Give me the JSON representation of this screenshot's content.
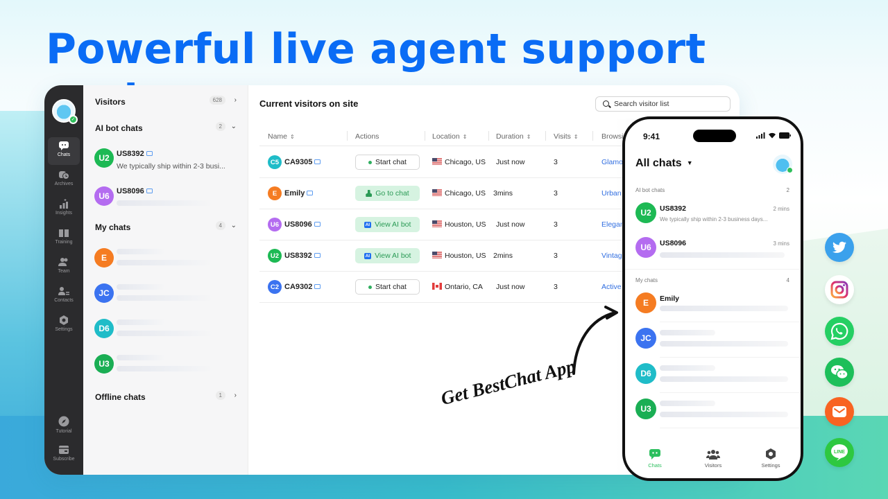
{
  "headline": "Powerful live agent support system",
  "rail": {
    "items": [
      {
        "label": "Chats",
        "icon": "chat-bubble-icon",
        "active": true
      },
      {
        "label": "Archives",
        "icon": "archive-clock-icon"
      },
      {
        "label": "Insights",
        "icon": "insights-chart-icon"
      },
      {
        "label": "Training",
        "icon": "book-icon"
      },
      {
        "label": "Team",
        "icon": "team-icon"
      },
      {
        "label": "Contacts",
        "icon": "contacts-icon"
      },
      {
        "label": "Settings",
        "icon": "gear-icon"
      }
    ],
    "bottom": [
      {
        "label": "Tutorial",
        "icon": "compass-icon"
      },
      {
        "label": "Subscribe",
        "icon": "card-icon"
      }
    ]
  },
  "list": {
    "visitors": {
      "title": "Visitors",
      "count": "628"
    },
    "ai_bot": {
      "title": "AI bot chats",
      "count": "2",
      "items": [
        {
          "initials": "U2",
          "color": "#1db954",
          "name": "US8392",
          "message": "We typically ship within 2-3 busi..."
        },
        {
          "initials": "U6",
          "color": "#b46cf0",
          "name": "US8096",
          "message": ""
        }
      ]
    },
    "my_chats": {
      "title": "My chats",
      "count": "4",
      "items": [
        {
          "initials": "E",
          "color": "#f57c22"
        },
        {
          "initials": "JC",
          "color": "#3b73f0"
        },
        {
          "initials": "D6",
          "color": "#1fbcc8"
        },
        {
          "initials": "U3",
          "color": "#1aae54"
        }
      ]
    },
    "offline": {
      "title": "Offline chats",
      "count": "1"
    }
  },
  "main": {
    "title": "Current visitors on site",
    "search_placeholder": "Search visitor list",
    "columns": [
      "Name",
      "Actions",
      "Location",
      "Duration",
      "Visits",
      "Browsi"
    ],
    "rows": [
      {
        "initials": "C5",
        "color": "#1fbcc8",
        "name": "CA9305",
        "action": "Start chat",
        "action_type": "start",
        "flag": "us",
        "location": "Chicago, US",
        "duration": "Just now",
        "visits": "3",
        "browsing": "Glamou"
      },
      {
        "initials": "E",
        "color": "#f57c22",
        "name": "Emily",
        "action": "Go to chat",
        "action_type": "go",
        "flag": "us",
        "location": "Chicago, US",
        "duration": "3mins",
        "visits": "3",
        "browsing": "Urban"
      },
      {
        "initials": "U6",
        "color": "#b46cf0",
        "name": "US8096",
        "action": "View AI bot",
        "action_type": "ai",
        "flag": "us",
        "location": "Houston, US",
        "duration": "Just now",
        "visits": "3",
        "browsing": "Elegan"
      },
      {
        "initials": "U2",
        "color": "#1db954",
        "name": "US8392",
        "action": "View AI bot",
        "action_type": "ai",
        "flag": "us",
        "location": "Houston, US",
        "duration": "2mins",
        "visits": "3",
        "browsing": "Vintage"
      },
      {
        "initials": "C2",
        "color": "#3b73f0",
        "name": "CA9302",
        "action": "Start chat",
        "action_type": "start",
        "flag": "ca",
        "location": "Ontario, CA",
        "duration": "Just now",
        "visits": "3",
        "browsing": "Active"
      }
    ],
    "ai_badge": "AI"
  },
  "cta": "Get BestChat App",
  "phone": {
    "time": "9:41",
    "title": "All chats",
    "ai_section": {
      "title": "AI bot chats",
      "count": "2"
    },
    "ai_items": [
      {
        "initials": "U2",
        "color": "#1db954",
        "name": "US8392",
        "time": "2 mins",
        "message": "We typically ship within 2-3 business days..."
      },
      {
        "initials": "U6",
        "color": "#b46cf0",
        "name": "US8096",
        "time": "3 mins",
        "message": ""
      }
    ],
    "my_section": {
      "title": "My chats",
      "count": "4"
    },
    "my_items": [
      {
        "initials": "E",
        "color": "#f57c22",
        "name": "Emily"
      },
      {
        "initials": "JC",
        "color": "#3b73f0",
        "name": ""
      },
      {
        "initials": "D6",
        "color": "#1fbcc8",
        "name": ""
      },
      {
        "initials": "U3",
        "color": "#1aae54",
        "name": ""
      }
    ],
    "tabs": [
      {
        "label": "Chats",
        "active": true
      },
      {
        "label": "Visitors"
      },
      {
        "label": "Settings"
      }
    ]
  },
  "social": [
    {
      "name": "twitter",
      "color": "#3ba1ec"
    },
    {
      "name": "instagram",
      "color": "#ffffff"
    },
    {
      "name": "whatsapp",
      "color": "#25cf63"
    },
    {
      "name": "wechat",
      "color": "#1dbf5a"
    },
    {
      "name": "email",
      "color": "#f86322"
    },
    {
      "name": "line",
      "color": "#2ec840"
    }
  ],
  "colors": {
    "brand": "#0a6cf5",
    "accent_green": "#2cbf5e",
    "rail_bg": "#2b2b2d"
  }
}
